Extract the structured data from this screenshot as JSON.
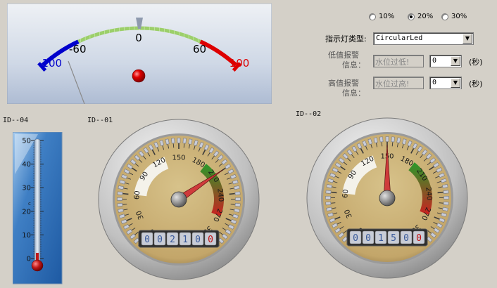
{
  "top_meter": {
    "scale_labels": [
      "-100",
      "-60",
      "0",
      "60",
      "100"
    ]
  },
  "options": {
    "radios": [
      {
        "label": "10%",
        "selected": false
      },
      {
        "label": "20%",
        "selected": true
      },
      {
        "label": "30%",
        "selected": false
      }
    ]
  },
  "form": {
    "indicator_type_label": "指示灯类型:",
    "indicator_type_value": "CircularLed",
    "low_alarm_label_1": "低值报警",
    "low_alarm_label_2": "信息：",
    "low_alarm_text": "水位过低!",
    "low_alarm_seconds": "0",
    "high_alarm_label_1": "高值报警",
    "high_alarm_label_2": "信息：",
    "high_alarm_text": "水位过高!",
    "high_alarm_seconds": "0",
    "seconds_unit": "(秒)"
  },
  "thermometer": {
    "id_label": "ID--04",
    "unit": "c",
    "scale_labels": [
      "50",
      "40",
      "30",
      "20",
      "10",
      "0"
    ],
    "value": 0
  },
  "gauge1": {
    "id_label": "ID--01",
    "scale_labels": [
      "0",
      "30",
      "60",
      "90",
      "120",
      "150",
      "180",
      "210",
      "240",
      "270",
      "300"
    ],
    "value": 210,
    "counter_digits": [
      "0",
      "0",
      "2",
      "1",
      "0",
      "0"
    ]
  },
  "gauge2": {
    "id_label": "ID--02",
    "scale_labels": [
      "0",
      "30",
      "60",
      "90",
      "120",
      "150",
      "180",
      "210",
      "240",
      "270",
      "300"
    ],
    "value": 150,
    "counter_digits": [
      "0",
      "0",
      "1",
      "5",
      "0",
      "0"
    ]
  },
  "colors": {
    "dial_face": "#c3a66a",
    "needle": "#cf3b3b",
    "blue_zone": "#0000cc",
    "red_zone": "#dd0000",
    "green_zone": "#9ccf6a",
    "led": "#dd0000"
  }
}
